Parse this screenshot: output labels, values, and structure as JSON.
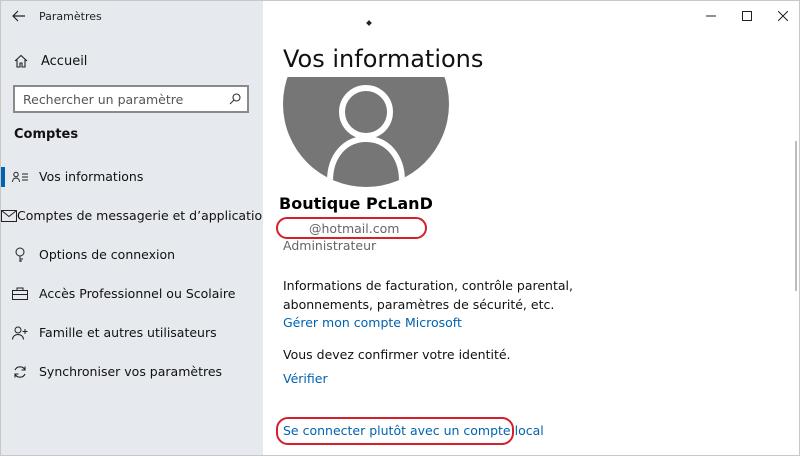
{
  "window": {
    "title": "Paramètres"
  },
  "sidebar": {
    "home_label": "Accueil",
    "search_placeholder": "Rechercher un paramètre",
    "section_title": "Comptes",
    "items": [
      {
        "label": "Vos informations",
        "icon": "person-card-icon",
        "active": true
      },
      {
        "label": "Comptes de messagerie et d’application",
        "icon": "mail-icon",
        "active": false
      },
      {
        "label": "Options de connexion",
        "icon": "key-icon",
        "active": false
      },
      {
        "label": "Accès Professionnel ou Scolaire",
        "icon": "briefcase-icon",
        "active": false
      },
      {
        "label": "Famille et autres utilisateurs",
        "icon": "person-add-icon",
        "active": false
      },
      {
        "label": "Synchroniser vos paramètres",
        "icon": "sync-icon",
        "active": false
      }
    ]
  },
  "main": {
    "title": "Vos informations",
    "user_name": "Boutique PcLanD",
    "email": "@hotmail.com",
    "role": "Administrateur",
    "info_text": "Informations de facturation, contrôle parental, abonnements, paramètres de sécurité, etc.",
    "manage_link": "Gérer mon compte Microsoft",
    "confirm_text": "Vous devez confirmer votre identité.",
    "verify_link": "Vérifier",
    "local_link": "Se connecter plutôt avec un compte local"
  },
  "colors": {
    "sidebar_bg": "#e6e9ee",
    "accent": "#0063b1",
    "highlight": "#d3202a",
    "avatar_bg": "#767676"
  }
}
